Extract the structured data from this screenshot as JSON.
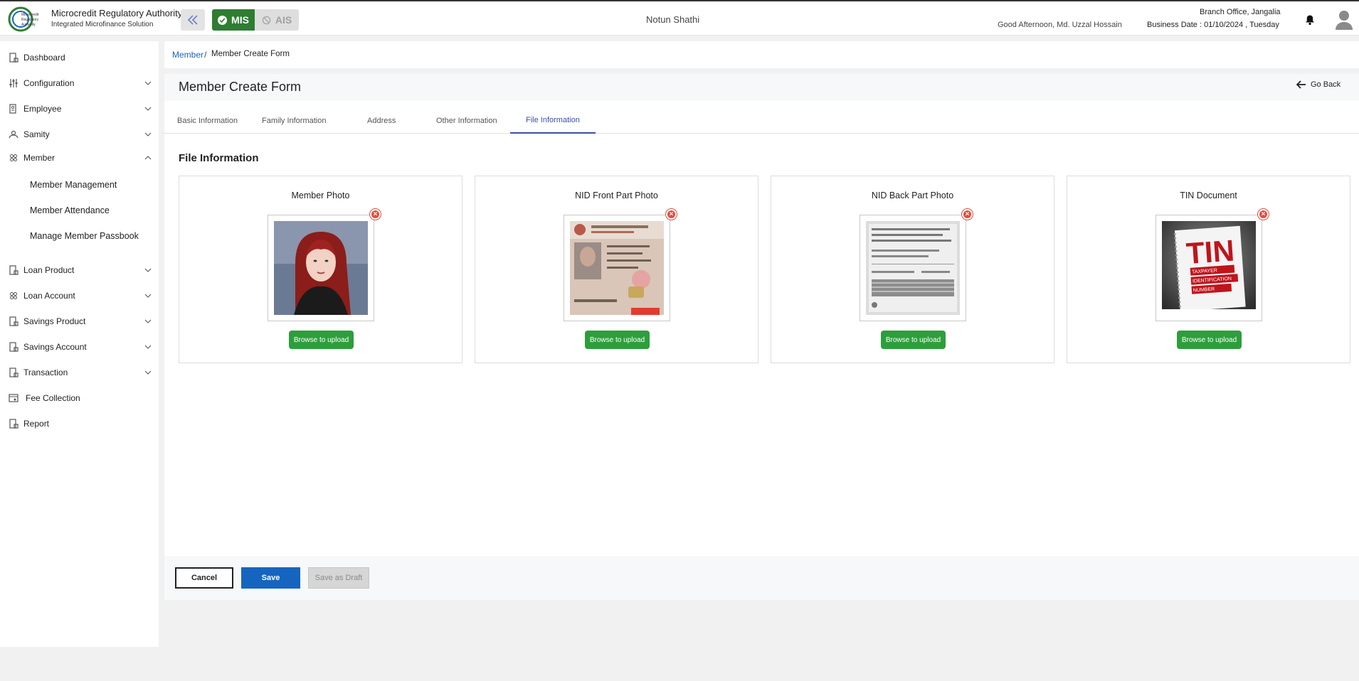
{
  "header": {
    "brand_title": "Microcredit Regulatory Authority",
    "brand_subtitle": "Integrated Microfinance Solution",
    "logo_text": "Microcredit Regulatory Authority",
    "mode_mis": "MIS",
    "mode_ais": "AIS",
    "org_name": "Notun Shathi",
    "greeting": "Good Afternoon, Md. Uzzal Hossain",
    "branch": "Branch Office, Jangalia",
    "business_date": "Business Date : 01/10/2024 , Tuesday"
  },
  "sidebar": {
    "items": [
      {
        "label": "Dashboard",
        "icon": "dashboard-icon"
      },
      {
        "label": "Configuration",
        "icon": "sliders-icon"
      },
      {
        "label": "Employee",
        "icon": "employee-icon"
      },
      {
        "label": "Samity",
        "icon": "samity-icon"
      },
      {
        "label": "Member",
        "icon": "member-icon"
      },
      {
        "label": "Loan Product",
        "icon": "loan-product-icon"
      },
      {
        "label": "Loan Account",
        "icon": "loan-account-icon"
      },
      {
        "label": "Savings Product",
        "icon": "savings-product-icon"
      },
      {
        "label": "Savings Account",
        "icon": "savings-account-icon"
      },
      {
        "label": "Transaction",
        "icon": "transaction-icon"
      },
      {
        "label": "Fee Collection",
        "icon": "fee-icon"
      },
      {
        "label": "Report",
        "icon": "report-icon"
      }
    ],
    "member_sub": [
      "Member Management",
      "Member Attendance",
      "Manage Member Passbook"
    ]
  },
  "breadcrumb": {
    "parent": "Member",
    "separator": "/",
    "current": "Member Create Form"
  },
  "page": {
    "title": "Member Create Form",
    "go_back": "Go Back"
  },
  "tabs": [
    "Basic Information",
    "Family Information",
    "Address",
    "Other Information",
    "File Information"
  ],
  "active_tab": "File Information",
  "section_title": "File Information",
  "cards": [
    {
      "title": "Member Photo",
      "button": "Browse to upload"
    },
    {
      "title": "NID Front Part Photo",
      "button": "Browse to upload"
    },
    {
      "title": "NID Back Part Photo",
      "button": "Browse to upload"
    },
    {
      "title": "TIN Document",
      "button": "Browse to upload"
    }
  ],
  "tin_image": {
    "big": "TIN",
    "lines": [
      "TAXPAYER",
      "IDENTIFICATION",
      "NUMBER"
    ]
  },
  "footer": {
    "cancel": "Cancel",
    "save": "Save",
    "draft": "Save as Draft"
  },
  "colors": {
    "primary_green": "#2e7d32",
    "upload_green": "#2e9e3c",
    "save_blue": "#1565c0",
    "active_tab": "#3a4ea8",
    "link_blue": "#1565c0",
    "remove_red": "#e74c3c"
  }
}
